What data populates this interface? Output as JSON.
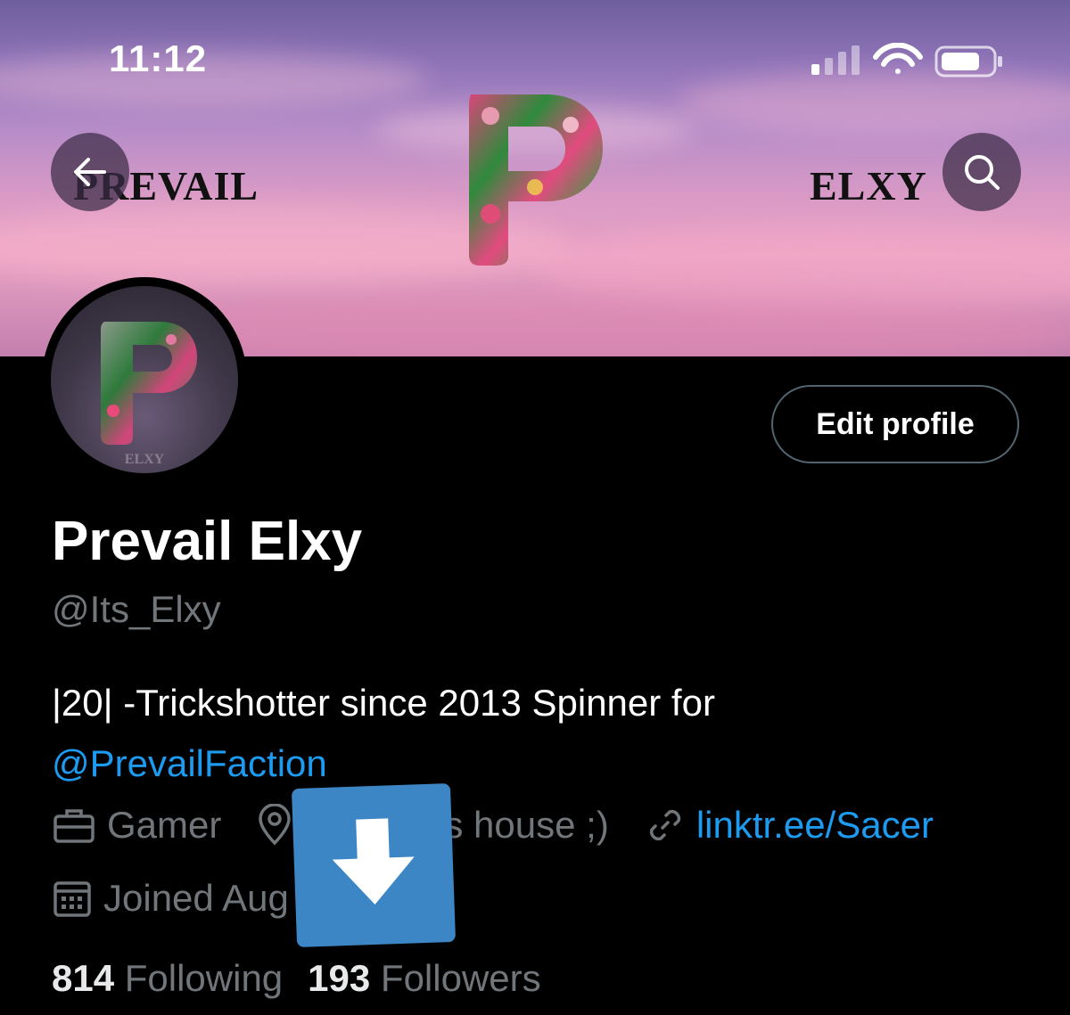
{
  "status_bar": {
    "time": "11:12"
  },
  "banner": {
    "left_text": "PREVAIL",
    "right_text": "ELXY"
  },
  "avatar": {
    "label": "ELXY"
  },
  "actions": {
    "edit_profile": "Edit profile"
  },
  "profile": {
    "name": "Prevail Elxy",
    "handle": "@Its_Elxy",
    "bio_text": "|20| -Trickshotter since 2013 Spinner for",
    "bio_mention": "@PrevailFaction",
    "profession": "Gamer",
    "location": "'s house ;)",
    "link": "linktr.ee/Sacer",
    "joined": "Joined Aug"
  },
  "counts": {
    "following_count": "814",
    "following_label": "Following",
    "followers_count": "193",
    "followers_label": "Followers"
  },
  "colors": {
    "accent": "#1d9bf0",
    "muted": "#71767b",
    "overlay": "#3d86c6"
  },
  "icons": [
    "back-arrow-icon",
    "search-icon",
    "briefcase-icon",
    "location-pin-icon",
    "link-icon",
    "calendar-icon",
    "download-arrow-icon",
    "signal-icon",
    "wifi-icon",
    "battery-icon"
  ]
}
